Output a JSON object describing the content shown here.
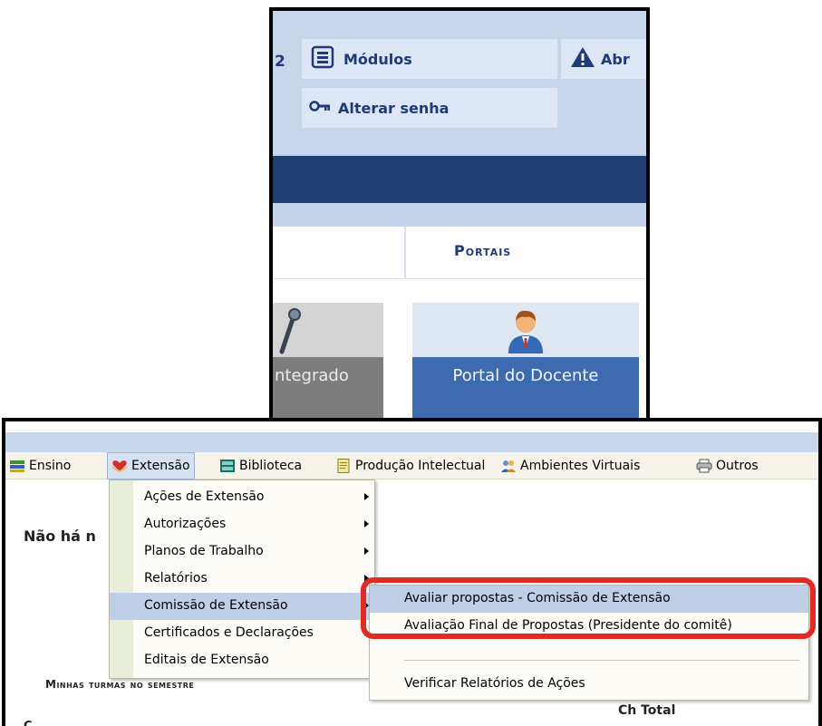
{
  "top": {
    "cut_number": "2",
    "modulos_label": "Módulos",
    "abr_label": "Abr",
    "alterar_senha_label": "Alterar senha",
    "portais_label": "Portais",
    "tile_left_label": "ntegrado",
    "tile_right_label": "Portal do Docente"
  },
  "menubar": {
    "items": [
      {
        "label": "Ensino",
        "icon": "books-icon"
      },
      {
        "label": "Extensão",
        "icon": "heart-hands-icon"
      },
      {
        "label": "Biblioteca",
        "icon": "library-icon"
      },
      {
        "label": "Produção Intelectual",
        "icon": "document-icon"
      },
      {
        "label": "Ambientes Virtuais",
        "icon": "people-icon"
      },
      {
        "label": "Outros",
        "icon": "printer-icon"
      }
    ]
  },
  "body": {
    "nao_ha": "Não há n",
    "minhas_turmas": "Minhas turmas no semestre",
    "ch_total": "Ch Total",
    "cut_text": "C"
  },
  "dropdown": {
    "items": [
      {
        "label": "Ações de Extensão",
        "has_submenu": true
      },
      {
        "label": "Autorizações",
        "has_submenu": true
      },
      {
        "label": "Planos de Trabalho",
        "has_submenu": true
      },
      {
        "label": "Relatórios",
        "has_submenu": true
      },
      {
        "label": "Comissão de Extensão",
        "has_submenu": true,
        "highlighted": true
      },
      {
        "label": "Certificados e Declarações",
        "has_submenu": true
      },
      {
        "label": "Editais de Extensão",
        "has_submenu": false
      }
    ]
  },
  "submenu": {
    "items": [
      {
        "label": "Avaliar propostas - Comissão de Extensão",
        "highlighted": true
      },
      {
        "label": "Avaliação Final de Propostas (Presidente do comitê)"
      },
      {
        "label": "Verificar Relatórios de Ações"
      }
    ]
  },
  "colors": {
    "highlight_border": "#e02a24",
    "nav_dark": "#1f3f73",
    "menu_hover": "#bfcfe7"
  }
}
